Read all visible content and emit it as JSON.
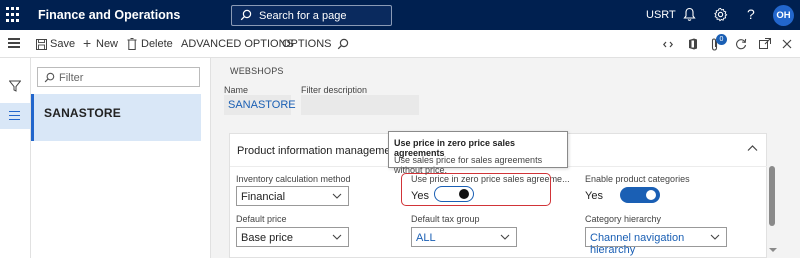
{
  "app": {
    "title": "Finance and Operations",
    "company": "USRT",
    "user_initials": "OH"
  },
  "search": {
    "placeholder": "Search for a page"
  },
  "icons": {
    "waffle": "waffle-icon",
    "search": "search-icon",
    "notifications": "bell-icon",
    "settings": "gear-icon",
    "help": "help-icon",
    "menu": "hamburger-icon",
    "save": "save-icon",
    "new": "plus-icon",
    "delete": "trash-icon",
    "filter": "funnel-icon",
    "list": "list-icon",
    "link": "link-icon",
    "office": "office-icon",
    "attachments": "paperclip-icon",
    "refresh": "refresh-icon",
    "open_new": "open-new-window-icon",
    "close": "close-icon"
  },
  "actions": {
    "save": "Save",
    "new": "New",
    "delete": "Delete",
    "advanced": "ADVANCED OPTIONS",
    "options": "OPTIONS"
  },
  "attachments_count": "0",
  "list": {
    "filter_placeholder": "Filter",
    "items": [
      "SANASTORE"
    ]
  },
  "header": {
    "caption": "WEBSHOPS",
    "name_label": "Name",
    "name_value": "SANASTORE",
    "filter_desc_label": "Filter description",
    "filter_desc_value": ""
  },
  "fasttab": {
    "title": "Product information management",
    "fields": {
      "inventory_label": "Inventory calculation method",
      "inventory_value": "Financial",
      "zero_price_label": "Use price in zero price sales agreeme...",
      "zero_price_value": "Yes",
      "categories_label": "Enable product categories",
      "categories_value": "Yes",
      "default_price_label": "Default price",
      "default_price_value": "Base price",
      "tax_group_label": "Default tax group",
      "tax_group_value": "ALL",
      "hierarchy_label": "Category hierarchy",
      "hierarchy_value": "Channel navigation hierarchy"
    }
  },
  "tooltip": {
    "title": "Use price in zero price sales agreements",
    "body": "Use sales price for sales agreements without price."
  },
  "colors": {
    "navbar": "#002050",
    "accent": "#1a5fb4",
    "highlight": "#d13438",
    "selection": "#d9e7f7"
  }
}
